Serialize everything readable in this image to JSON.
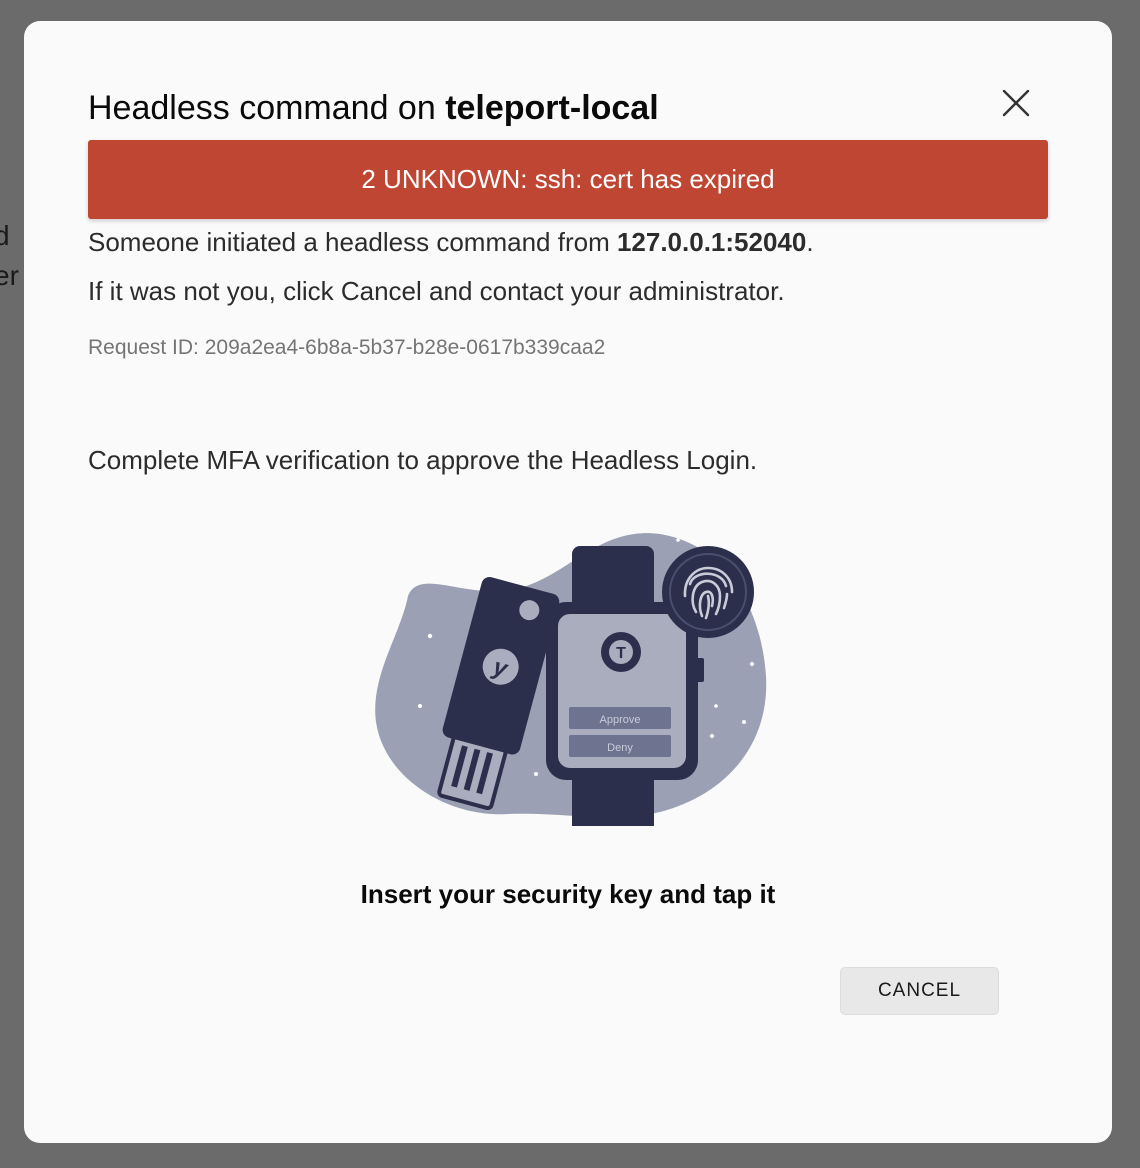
{
  "backdrop": {
    "fragment_1": "d",
    "fragment_2": "er"
  },
  "modal": {
    "title_prefix": "Headless command on ",
    "title_host": "teleport-local",
    "error_message": "2 UNKNOWN: ssh: cert has expired",
    "initiated_prefix": "Someone initiated a headless command from ",
    "initiated_address": "127.0.0.1:52040",
    "initiated_suffix": ".",
    "warning_text": "If it was not you, click Cancel and contact your administrator.",
    "request_id_label": "Request ID: ",
    "request_id_value": "209a2ea4-6b8a-5b37-b28e-0617b339caa2",
    "mfa_prompt": "Complete MFA verification to approve the Headless Login.",
    "illustration": {
      "approve_label": "Approve",
      "deny_label": "Deny",
      "key_logo": "y",
      "watch_logo": "T"
    },
    "instruction": "Insert your security key and tap it",
    "cancel_label": "CANCEL"
  },
  "colors": {
    "error_banner": "#c04634",
    "illustration_blob": "#9ca0b5",
    "illustration_dark": "#2b2f4c"
  }
}
